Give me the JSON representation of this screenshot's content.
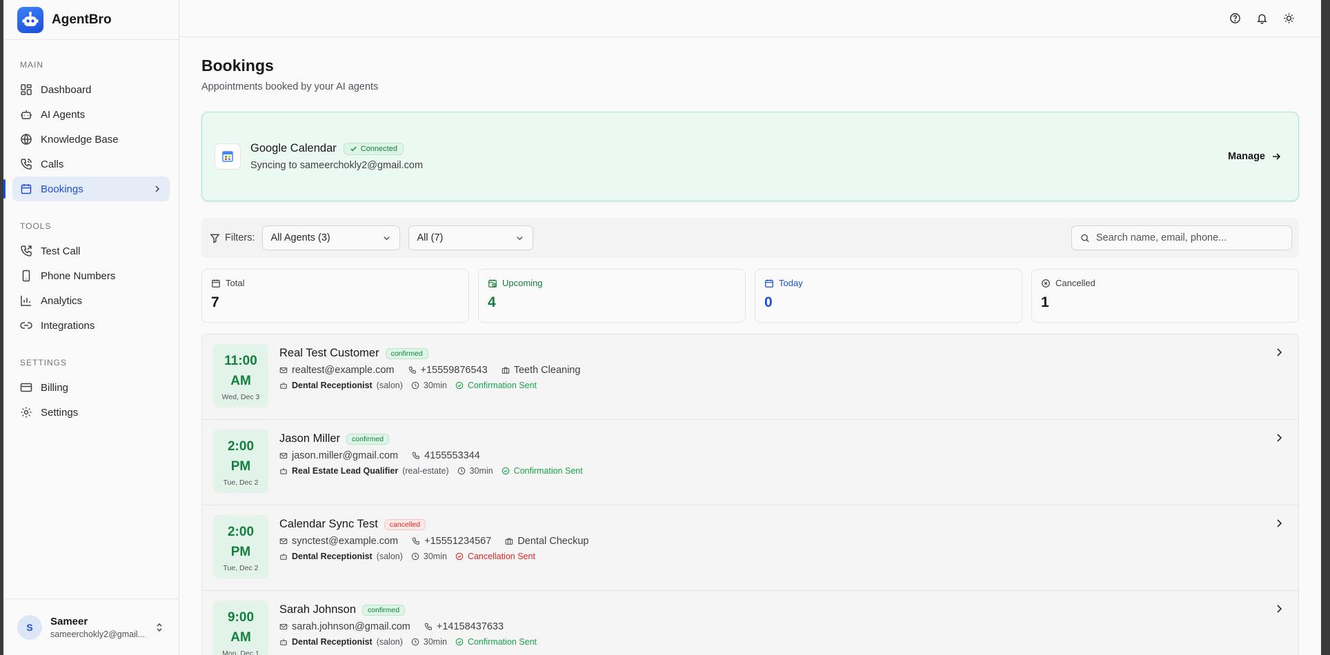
{
  "brand": {
    "name": "AgentBro"
  },
  "sidebar": {
    "sections": [
      {
        "heading": "MAIN",
        "items": [
          {
            "label": "Dashboard",
            "icon": "grid-icon"
          },
          {
            "label": "AI Agents",
            "icon": "bot-icon"
          },
          {
            "label": "Knowledge Base",
            "icon": "globe-icon"
          },
          {
            "label": "Calls",
            "icon": "phone-icon"
          },
          {
            "label": "Bookings",
            "icon": "calendar-icon",
            "active": true
          }
        ]
      },
      {
        "heading": "TOOLS",
        "items": [
          {
            "label": "Test Call",
            "icon": "phone-outgoing-icon"
          },
          {
            "label": "Phone Numbers",
            "icon": "smartphone-icon"
          },
          {
            "label": "Analytics",
            "icon": "bar-chart-icon"
          },
          {
            "label": "Integrations",
            "icon": "link-icon"
          }
        ]
      },
      {
        "heading": "SETTINGS",
        "items": [
          {
            "label": "Billing",
            "icon": "credit-card-icon"
          },
          {
            "label": "Settings",
            "icon": "gear-icon"
          }
        ]
      }
    ],
    "user": {
      "initial": "S",
      "name": "Sameer",
      "email": "sameerchokly2@gmail..."
    }
  },
  "page": {
    "title": "Bookings",
    "subtitle": "Appointments booked by your AI agents"
  },
  "gcal": {
    "title": "Google Calendar",
    "status": "Connected",
    "sync_text": "Syncing to sameerchokly2@gmail.com",
    "manage_label": "Manage"
  },
  "filters": {
    "label": "Filters:",
    "agent_select": "All Agents (3)",
    "status_select": "All (7)",
    "search_placeholder": "Search name, email, phone..."
  },
  "stats": [
    {
      "label": "Total",
      "value": "7",
      "tone": "neutral",
      "icon": "calendar-icon"
    },
    {
      "label": "Upcoming",
      "value": "4",
      "tone": "green",
      "icon": "calendar-clock-icon"
    },
    {
      "label": "Today",
      "value": "0",
      "tone": "blue",
      "icon": "calendar-icon"
    },
    {
      "label": "Cancelled",
      "value": "1",
      "tone": "neutral",
      "icon": "x-circle-icon"
    }
  ],
  "bookings": [
    {
      "time": "11:00",
      "ampm": "AM",
      "date": "Wed, Dec 3",
      "name": "Real Test Customer",
      "status": "confirmed",
      "email": "realtest@example.com",
      "phone": "+15559876543",
      "service": "Teeth Cleaning",
      "agent": "Dental Receptionist",
      "agent_type": "(salon)",
      "duration": "30min",
      "notice": "Confirmation Sent",
      "notice_tone": "green"
    },
    {
      "time": "2:00",
      "ampm": "PM",
      "date": "Tue, Dec 2",
      "name": "Jason Miller",
      "status": "confirmed",
      "email": "jason.miller@gmail.com",
      "phone": "4155553344",
      "service": "",
      "agent": "Real Estate Lead Qualifier",
      "agent_type": "(real-estate)",
      "duration": "30min",
      "notice": "Confirmation Sent",
      "notice_tone": "green"
    },
    {
      "time": "2:00",
      "ampm": "PM",
      "date": "Tue, Dec 2",
      "name": "Calendar Sync Test",
      "status": "cancelled",
      "email": "synctest@example.com",
      "phone": "+15551234567",
      "service": "Dental Checkup",
      "agent": "Dental Receptionist",
      "agent_type": "(salon)",
      "duration": "30min",
      "notice": "Cancellation Sent",
      "notice_tone": "red"
    },
    {
      "time": "9:00",
      "ampm": "AM",
      "date": "Mon, Dec 1",
      "name": "Sarah Johnson",
      "status": "confirmed",
      "email": "sarah.johnson@gmail.com",
      "phone": "+14158437633",
      "service": "",
      "agent": "Dental Receptionist",
      "agent_type": "(salon)",
      "duration": "30min",
      "notice": "Confirmation Sent",
      "notice_tone": "green"
    }
  ],
  "colors": {
    "accent": "#1d4ed8",
    "success": "#15803d",
    "danger": "#dc2626"
  }
}
